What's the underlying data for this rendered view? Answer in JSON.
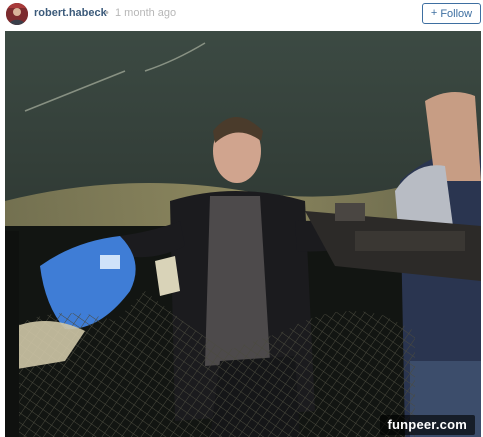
{
  "post": {
    "username": "robert.habeck",
    "separator": "•",
    "time_ago": "1 month ago",
    "follow": {
      "icon": "+",
      "label": "Follow"
    },
    "photo": {
      "watermark": "funpeer.com"
    }
  },
  "colors": {
    "username": "#3b5a7a",
    "follow_accent": "#3e6fa1",
    "muted": "#b7b7b7"
  },
  "icons": {
    "avatar": "profile-avatar",
    "follow": "plus-icon"
  }
}
